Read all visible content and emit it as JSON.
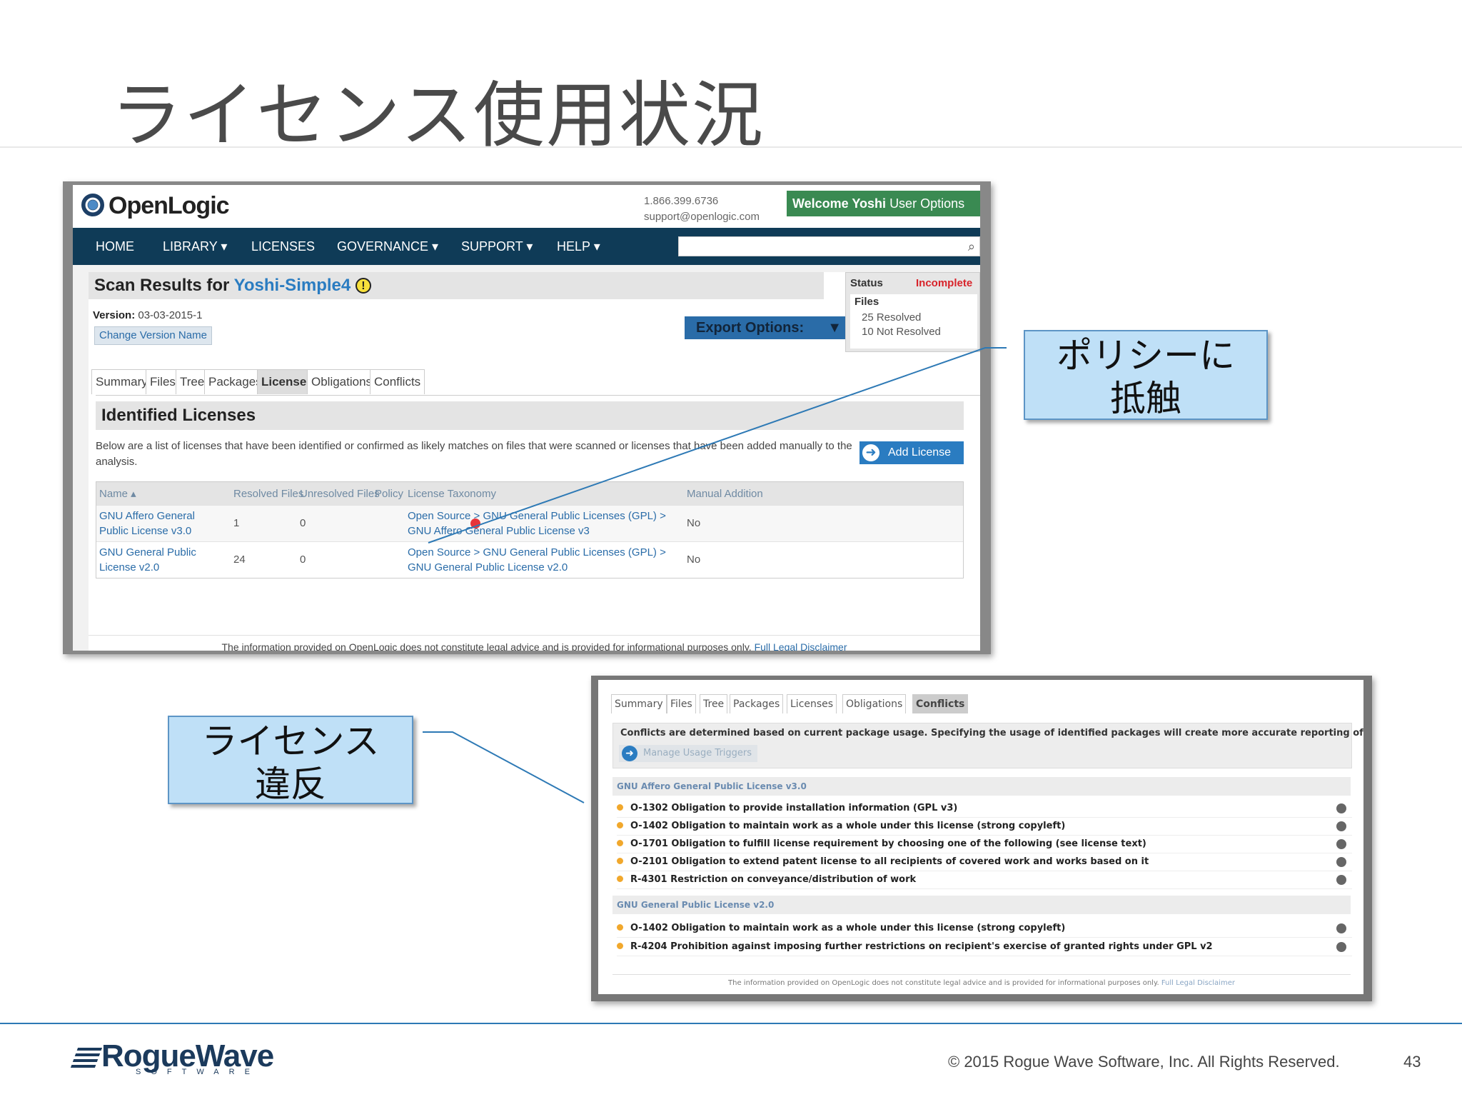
{
  "slide": {
    "title": "ライセンス使用状況",
    "page_number": "43",
    "copyright": "© 2015 Rogue Wave Software, Inc. All Rights Reserved.",
    "logo_text": "RogueWave",
    "logo_sub": "SOFTWARE"
  },
  "callouts": {
    "policy": [
      "ポリシーに",
      "抵触"
    ],
    "violation": [
      "ライセンス",
      "違反"
    ]
  },
  "openlogic": {
    "logo": "OpenLogic",
    "phone": "1.866.399.6736",
    "email": "support@openlogic.com",
    "welcome_bold": "Welcome Yoshi",
    "welcome_options": "User Options",
    "nav": [
      "HOME",
      "LIBRARY ▾",
      "LICENSES",
      "GOVERNANCE ▾",
      "SUPPORT ▾",
      "HELP ▾"
    ],
    "search_placeholder": "",
    "scan_title_prefix": "Scan Results for ",
    "scan_project": "Yoshi-Simple4",
    "version_label": "Version:",
    "version_value": "03-03-2015-1",
    "change_version": "Change Version Name",
    "export_options": "Export Options:",
    "status_label": "Status",
    "status_value": "Incomplete",
    "files_label": "Files",
    "files_resolved": "25 Resolved",
    "files_not_resolved": "10 Not Resolved",
    "tabs": [
      "Summary",
      "Files",
      "Tree",
      "Packages",
      "Licenses",
      "Obligations",
      "Conflicts"
    ],
    "active_tab": "Licenses",
    "identified_title": "Identified Licenses",
    "identified_desc": "Below are a list of licenses that have been identified or confirmed as likely matches on files that were scanned or licenses that have been added manually to the analysis.",
    "add_license": "Add License",
    "table_headers": [
      "Name ▴",
      "Resolved Files",
      "Unresolved Files",
      "Policy",
      "License Taxonomy",
      "Manual Addition"
    ],
    "table_rows": [
      {
        "name": "GNU Affero General Public License v3.0",
        "resolved": "1",
        "unresolved": "0",
        "policy": "violation",
        "taxonomy": "Open Source > GNU General Public Licenses (GPL) > GNU Affero General Public License v3",
        "manual": "No"
      },
      {
        "name": "GNU General Public License v2.0",
        "resolved": "24",
        "unresolved": "0",
        "policy": "",
        "taxonomy": "Open Source > GNU General Public Licenses (GPL) > GNU General Public License v2.0",
        "manual": "No"
      }
    ],
    "disclaimer": "The information provided on OpenLogic does not constitute legal advice and is provided for informational purposes only.",
    "disclaimer_link": "Full Legal Disclaimer",
    "policy_dot_color": "#e8343a"
  },
  "conflicts": {
    "tabs": [
      "Summary",
      "Files",
      "Tree",
      "Packages",
      "Licenses",
      "Obligations",
      "Conflicts"
    ],
    "active_tab": "Conflicts",
    "desc": "Conflicts are determined based on current package usage. Specifying the usage of identified packages will create more accurate reporting of conflicts.",
    "manage_triggers": "Manage Usage Triggers",
    "groups": [
      {
        "name": "GNU Affero General Public License v3.0",
        "items": [
          "O-1302 Obligation to provide installation information (GPL v3)",
          "O-1402 Obligation to maintain work as a whole under this license (strong copyleft)",
          "O-1701 Obligation to fulfill license requirement by choosing one of the following (see license text)",
          "O-2101 Obligation to extend patent license to all recipients of covered work and works based on it",
          "R-4301 Restriction on conveyance/distribution of work"
        ]
      },
      {
        "name": "GNU General Public License v2.0",
        "items": [
          "O-1402 Obligation to maintain work as a whole under this license (strong copyleft)",
          "R-4204 Prohibition against imposing further restrictions on recipient's exercise of granted rights under GPL v2"
        ]
      }
    ],
    "disclaimer": "The information provided on OpenLogic does not constitute legal advice and is provided for informational purposes only.",
    "disclaimer_link": "Full Legal Disclaimer"
  },
  "colors": {
    "nav_bg": "#0f3b57",
    "welcome_bg": "#3a8a52",
    "accent_blue": "#2a7cc1",
    "callout_bg": "#bfe0f7",
    "incomplete_red": "#d8232a",
    "footer_rule": "#2d79b5"
  }
}
